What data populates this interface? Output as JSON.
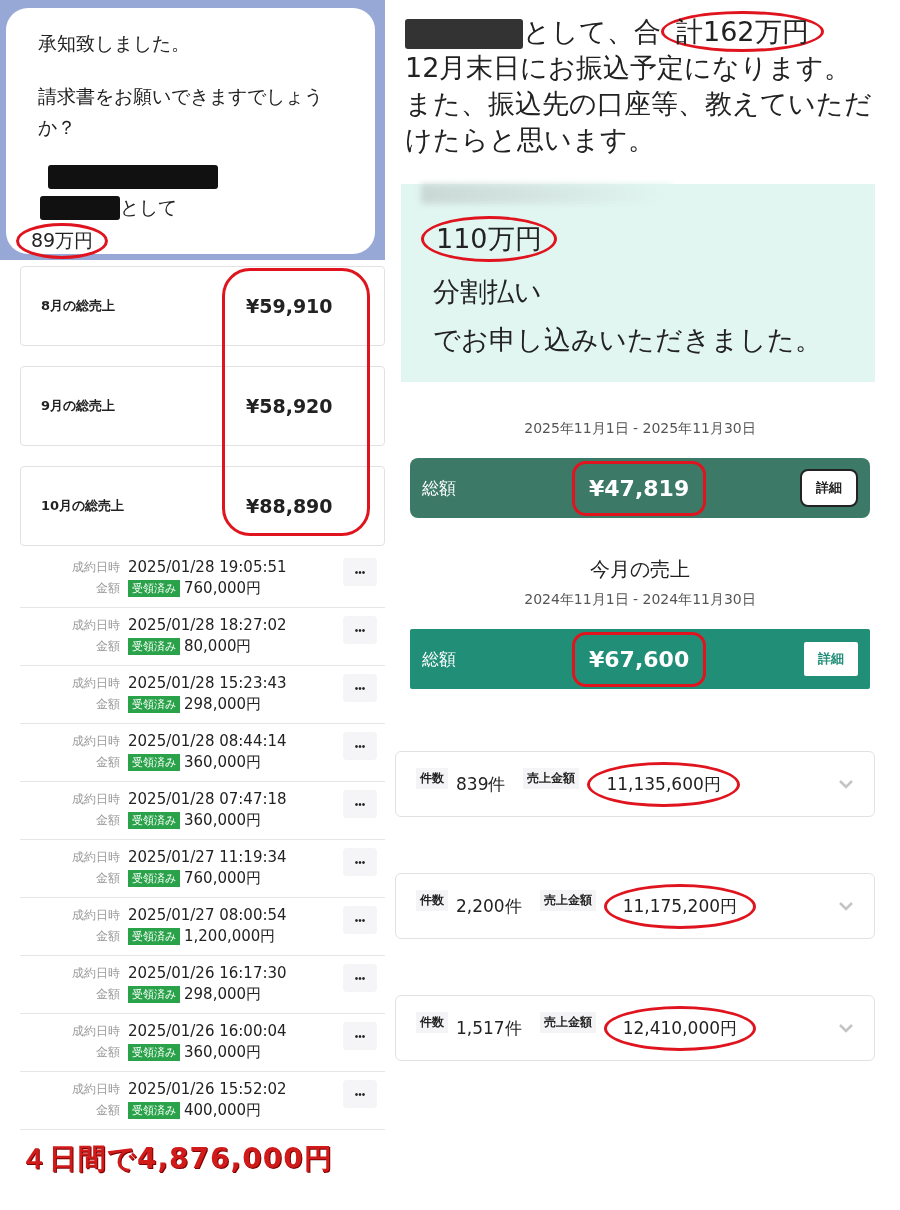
{
  "chat_message": {
    "lines": [
      "承知致しました。",
      "請求書をお願いできますでしょうか？"
    ],
    "suffix": "として",
    "amount": "89万円",
    "circled": true
  },
  "message": {
    "prefix": "として、合",
    "highlight": "計162万円",
    "circled": true,
    "paragraphs": [
      "12月末日にお振込予定になります。",
      "また、振込先の口座等、教えていただけたらと思います。"
    ]
  },
  "monthly_sales": {
    "highlighted": true,
    "items": [
      {
        "label": "8月の総売上",
        "amount": "¥59,910"
      },
      {
        "label": "9月の総売上",
        "amount": "¥58,920"
      },
      {
        "label": "10月の総売上",
        "amount": "¥88,890"
      }
    ]
  },
  "transactions": {
    "rows": [
      {
        "date_label": "成約日時",
        "datetime": "2025/01/28 19:05:51",
        "amount_label": "金額",
        "status": "受領済み",
        "amount": "760,000円",
        "more": "•••"
      },
      {
        "date_label": "成約日時",
        "datetime": "2025/01/28 18:27:02",
        "amount_label": "金額",
        "status": "受領済み",
        "amount": "80,000円",
        "more": "•••"
      },
      {
        "date_label": "成約日時",
        "datetime": "2025/01/28 15:23:43",
        "amount_label": "金額",
        "status": "受領済み",
        "amount": "298,000円",
        "more": "•••"
      },
      {
        "date_label": "成約日時",
        "datetime": "2025/01/28 08:44:14",
        "amount_label": "金額",
        "status": "受領済み",
        "amount": "360,000円",
        "more": "•••"
      },
      {
        "date_label": "成約日時",
        "datetime": "2025/01/28 07:47:18",
        "amount_label": "金額",
        "status": "受領済み",
        "amount": "360,000円",
        "more": "•••"
      },
      {
        "date_label": "成約日時",
        "datetime": "2025/01/27 11:19:34",
        "amount_label": "金額",
        "status": "受領済み",
        "amount": "760,000円",
        "more": "•••"
      },
      {
        "date_label": "成約日時",
        "datetime": "2025/01/27 08:00:54",
        "amount_label": "金額",
        "status": "受領済み",
        "amount": "1,200,000円",
        "more": "•••"
      },
      {
        "date_label": "成約日時",
        "datetime": "2025/01/26 16:17:30",
        "amount_label": "金額",
        "status": "受領済み",
        "amount": "298,000円",
        "more": "•••"
      },
      {
        "date_label": "成約日時",
        "datetime": "2025/01/26 16:00:04",
        "amount_label": "金額",
        "status": "受領済み",
        "amount": "360,000円",
        "more": "•••"
      },
      {
        "date_label": "成約日時",
        "datetime": "2025/01/26 15:52:02",
        "amount_label": "金額",
        "status": "受領済み",
        "amount": "400,000円",
        "more": "•••"
      }
    ]
  },
  "caption": "４日間で4,876,000円",
  "application_notice": {
    "amount": "110万円",
    "circled": true,
    "lines": [
      "分割払い",
      "でお申し込みいただきました。"
    ]
  },
  "summaries": [
    {
      "kind": "dark",
      "period": "2025年11月1日 - 2025年11月30日",
      "label": "総額",
      "amount": "¥47,819",
      "circled": true,
      "button": "詳細"
    },
    {
      "kind": "teal",
      "heading": "今月の売上",
      "period": "2024年11月1日 - 2024年11月30日",
      "label": "総額",
      "amount": "¥67,600",
      "circled": true,
      "button": "詳細"
    }
  ],
  "stat_cards": [
    {
      "count_label": "件数",
      "count": "839件",
      "sales_label": "売上金額",
      "sales": "11,135,600円",
      "circled": true
    },
    {
      "count_label": "件数",
      "count": "2,200件",
      "sales_label": "売上金額",
      "sales": "11,175,200円",
      "circled": true
    },
    {
      "count_label": "件数",
      "count": "1,517件",
      "sales_label": "売上金額",
      "sales": "12,410,000円",
      "circled": true
    }
  ]
}
